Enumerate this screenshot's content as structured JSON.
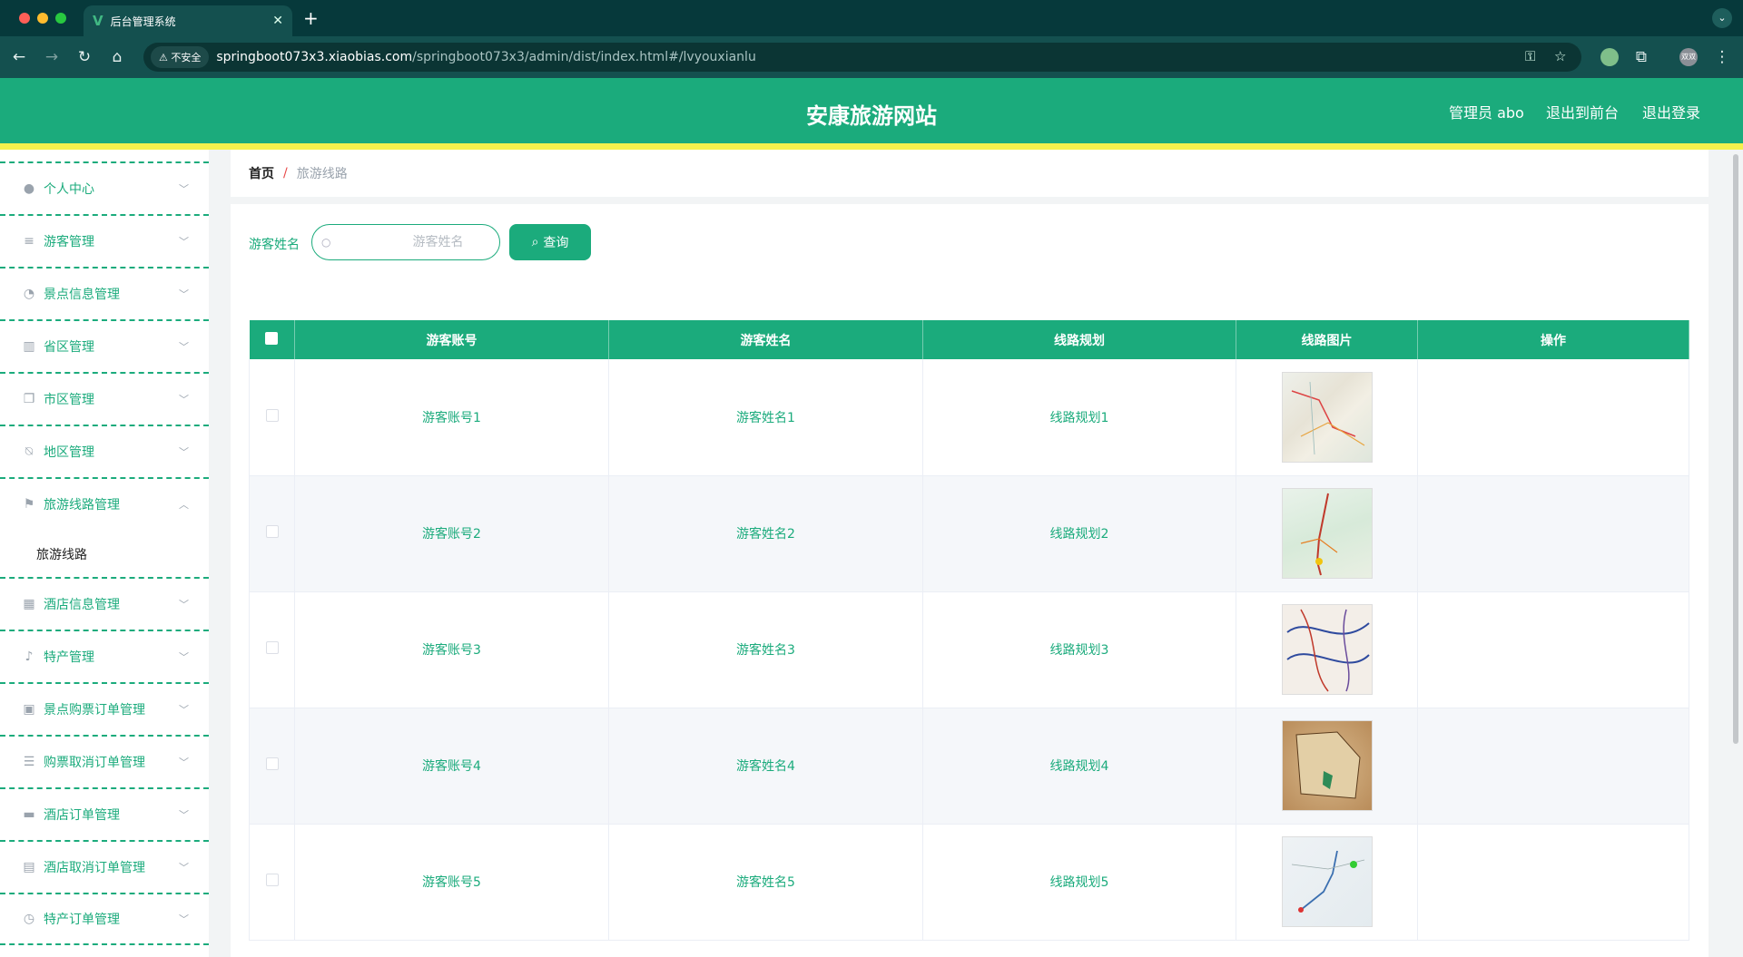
{
  "browser": {
    "tab_title": "后台管理系统",
    "url_host": "springboot073x3.xiaobias.com",
    "url_path": "/springboot073x3/admin/dist/index.html#/lvyouxianlu",
    "insecure_label": "不安全",
    "profile_label": "双双"
  },
  "header": {
    "title": "安康旅游网站",
    "user": "管理员 abo",
    "to_front": "退出到前台",
    "logout": "退出登录"
  },
  "sidebar": {
    "items": [
      {
        "label": "个人中心",
        "icon": "person-icon"
      },
      {
        "label": "游客管理",
        "icon": "list-icon"
      },
      {
        "label": "景点信息管理",
        "icon": "gauge-icon"
      },
      {
        "label": "省区管理",
        "icon": "bar-chart-icon"
      },
      {
        "label": "市区管理",
        "icon": "copy-icon"
      },
      {
        "label": "地区管理",
        "icon": "bell-off-icon"
      },
      {
        "label": "旅游线路管理",
        "icon": "flag-icon",
        "expanded": true
      },
      {
        "label": "酒店信息管理",
        "icon": "grid-icon"
      },
      {
        "label": "特产管理",
        "icon": "microphone-icon"
      },
      {
        "label": "景点购票订单管理",
        "icon": "clipboard-icon"
      },
      {
        "label": "购票取消订单管理",
        "icon": "menu-lines-icon"
      },
      {
        "label": "酒店订单管理",
        "icon": "monitor-icon"
      },
      {
        "label": "酒店取消订单管理",
        "icon": "printer-icon"
      },
      {
        "label": "特产订单管理",
        "icon": "clock-icon"
      }
    ],
    "sub_item": "旅游线路"
  },
  "breadcrumb": {
    "home": "首页",
    "separator": "/",
    "current": "旅游线路"
  },
  "search": {
    "label": "游客姓名",
    "placeholder": "游客姓名",
    "value": "",
    "button": "查询"
  },
  "table": {
    "headers": [
      "游客账号",
      "游客姓名",
      "线路规划",
      "线路图片",
      "操作"
    ],
    "rows": [
      {
        "account": "游客账号1",
        "name": "游客姓名1",
        "route": "线路规划1"
      },
      {
        "account": "游客账号2",
        "name": "游客姓名2",
        "route": "线路规划2"
      },
      {
        "account": "游客账号3",
        "name": "游客姓名3",
        "route": "线路规划3"
      },
      {
        "account": "游客账号4",
        "name": "游客姓名4",
        "route": "线路规划4"
      },
      {
        "account": "游客账号5",
        "name": "游客姓名5",
        "route": "线路规划5"
      }
    ]
  },
  "colors": {
    "primary": "#1bab7c",
    "accent_strip": "#f4f14d",
    "browser_dark": "#06393b"
  }
}
